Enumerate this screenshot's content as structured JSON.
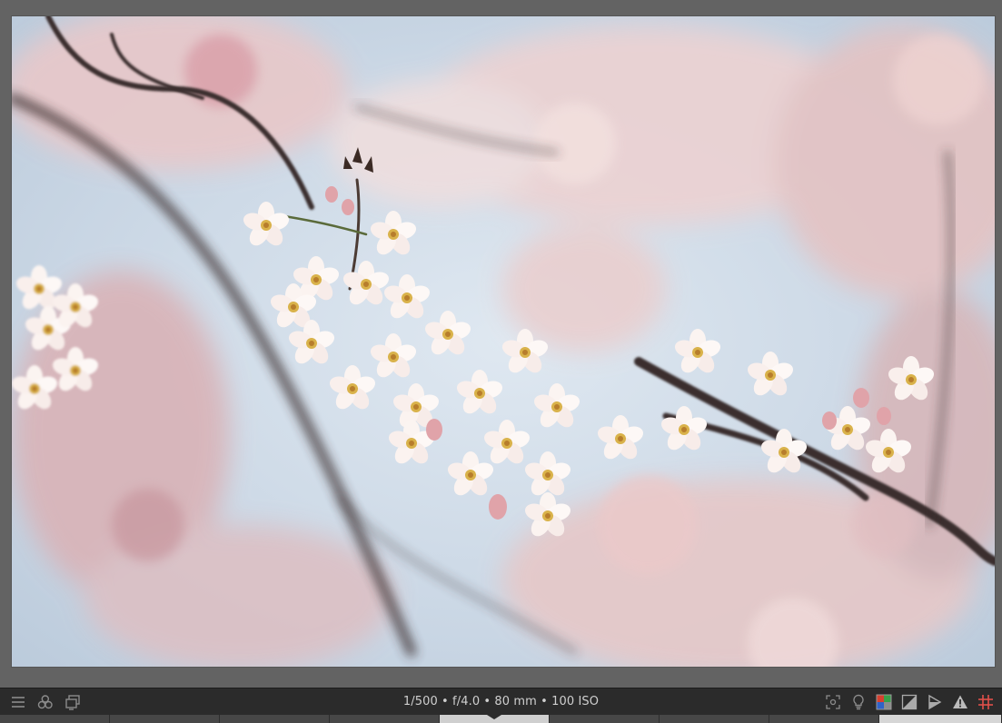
{
  "toolbar": {
    "exposure_info": "1/500 • f/4.0 • 80 mm • 100 ISO",
    "left_icons": [
      "menu-icon",
      "color-labels-icon",
      "second-window-icon"
    ],
    "right_icons": [
      "focus-peaking-icon",
      "display-profile-icon",
      "color-assessment-icon",
      "overexposure-icon",
      "softproof-icon",
      "gamut-check-icon",
      "guides-icon"
    ]
  },
  "colors": {
    "toolbar_bg": "#2b2b2b",
    "viewport_bg": "#636363",
    "text": "#cfcfcf",
    "guides": "#e0504a"
  },
  "filmstrip": {
    "active_index": 4
  }
}
